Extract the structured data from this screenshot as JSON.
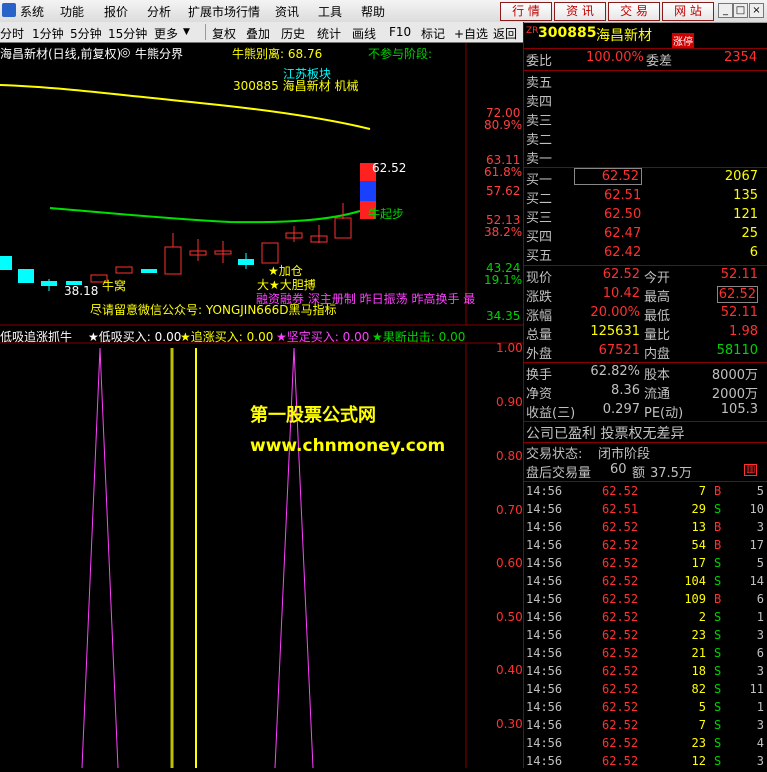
{
  "menu": {
    "items": [
      "系统",
      "功能",
      "报价",
      "分析",
      "扩展市场行情",
      "资讯",
      "工具",
      "帮助"
    ],
    "right_buttons": [
      "行 情",
      "资 讯",
      "交 易",
      "网 站"
    ]
  },
  "toolbar": {
    "left_items": [
      "分时",
      "1分钟",
      "5分钟",
      "15分钟",
      "更多"
    ],
    "right_items": [
      "复权",
      "叠加",
      "历史",
      "统计",
      "画线",
      "F10",
      "标记",
      "+自选",
      "返回"
    ]
  },
  "main_chart": {
    "title": "海昌新材(日线,前复权)",
    "indicator_label": "牛熊分界",
    "bull_bear_value_label": "牛熊别离: 68.76",
    "phase_label": "不参与阶段: ",
    "annot_jiangsu": "江苏板块",
    "annot_machinery": "300885 海昌新材 机械",
    "last_price_label": "62.52",
    "low_price_label": "38.18",
    "niu_qibu": "牛起步",
    "jiacang": "★加仓",
    "dadan": "大★大胆搏",
    "niuwo": "牛窝",
    "notice": "尽请留意微信公众号: YONGJIN666D黑马指标",
    "scroll_text": "融资融券 深主册制 昨日振荡 昨高换手 最",
    "axis_labels": [
      {
        "v": "72.00",
        "c": "#ff4040"
      },
      {
        "v": "80.9%",
        "c": "#ff4040"
      },
      {
        "v": "63.11",
        "c": "#ff4040"
      },
      {
        "v": "61.8%",
        "c": "#ff4040"
      },
      {
        "v": "57.62",
        "c": "#ff4040"
      },
      {
        "v": "52.13",
        "c": "#ff4040"
      },
      {
        "v": "38.2%",
        "c": "#ff4040"
      },
      {
        "v": "43.24",
        "c": "#00d200"
      },
      {
        "v": "19.1%",
        "c": "#00d200"
      },
      {
        "v": "34.35",
        "c": "#00d200"
      }
    ]
  },
  "sub_chart": {
    "name": "低吸追涨抓牛",
    "legend": [
      {
        "label": "★低吸买入: 0.00",
        "color": "#ffffff"
      },
      {
        "label": "★追涨买入: 0.00",
        "color": "#ffff00"
      },
      {
        "label": "★坚定买入: 0.00",
        "color": "#ff40ff"
      },
      {
        "label": "★果断出击: 0.00",
        "color": "#00d200"
      }
    ],
    "axis": [
      "1.00",
      "0.90",
      "0.80",
      "0.70",
      "0.60",
      "0.50",
      "0.40",
      "0.30"
    ],
    "watermark1": "第一股票公式网",
    "watermark2": "www.chnmoney.com"
  },
  "quote": {
    "code": "300885",
    "name": "海昌新材",
    "tag": "涨停",
    "weibi_label": "委比",
    "weibi": "100.00%",
    "weicha_label": "委差",
    "weicha": "2354",
    "sell_labels": [
      "卖五",
      "卖四",
      "卖三",
      "卖二",
      "卖一"
    ],
    "buy": [
      {
        "label": "买一",
        "price": "62.52",
        "vol": "2067"
      },
      {
        "label": "买二",
        "price": "62.51",
        "vol": "135"
      },
      {
        "label": "买三",
        "price": "62.50",
        "vol": "121"
      },
      {
        "label": "买四",
        "price": "62.47",
        "vol": "25"
      },
      {
        "label": "买五",
        "price": "62.42",
        "vol": "6"
      }
    ],
    "stats": [
      {
        "l1": "现价",
        "v1": "62.52",
        "l2": "今开",
        "v2": "52.11",
        "c1": "#ff3030",
        "c2": "#ff3030"
      },
      {
        "l1": "涨跌",
        "v1": "10.42",
        "l2": "最高",
        "v2": "62.52",
        "c1": "#ff3030",
        "c2": "#ff3030"
      },
      {
        "l1": "涨幅",
        "v1": "20.00%",
        "l2": "最低",
        "v2": "52.11",
        "c1": "#ff3030",
        "c2": "#ff3030"
      },
      {
        "l1": "总量",
        "v1": "125631",
        "l2": "量比",
        "v2": "1.98",
        "c1": "#ffff00",
        "c2": "#ff3030"
      },
      {
        "l1": "外盘",
        "v1": "67521",
        "l2": "内盘",
        "v2": "58110",
        "c1": "#ff3030",
        "c2": "#00d200"
      }
    ],
    "stats2": [
      {
        "l1": "换手",
        "v1": "62.82%",
        "l2": "股本",
        "v2": "8000万"
      },
      {
        "l1": "净资",
        "v1": "8.36",
        "l2": "流通",
        "v2": "2000万"
      },
      {
        "l1": "收益(三)",
        "v1": "0.297",
        "l2": "PE(动)",
        "v2": "105.3"
      }
    ],
    "profit_line": "公司已盈利 投票权无差异",
    "trade_state_label": "交易状态:",
    "trade_state": "闭市阶段",
    "after_label": "盘后交易量",
    "after_vol": "60",
    "after_amt_label": "额",
    "after_amt": "37.5万"
  },
  "ticks": [
    {
      "t": "14:56",
      "p": "62.52",
      "v": "7",
      "d": "B",
      "n": "5"
    },
    {
      "t": "14:56",
      "p": "62.51",
      "v": "29",
      "d": "S",
      "n": "10"
    },
    {
      "t": "14:56",
      "p": "62.52",
      "v": "13",
      "d": "B",
      "n": "3"
    },
    {
      "t": "14:56",
      "p": "62.52",
      "v": "54",
      "d": "B",
      "n": "17"
    },
    {
      "t": "14:56",
      "p": "62.52",
      "v": "17",
      "d": "S",
      "n": "5"
    },
    {
      "t": "14:56",
      "p": "62.52",
      "v": "104",
      "d": "S",
      "n": "14"
    },
    {
      "t": "14:56",
      "p": "62.52",
      "v": "109",
      "d": "B",
      "n": "6"
    },
    {
      "t": "14:56",
      "p": "62.52",
      "v": "2",
      "d": "S",
      "n": "1"
    },
    {
      "t": "14:56",
      "p": "62.52",
      "v": "23",
      "d": "S",
      "n": "3"
    },
    {
      "t": "14:56",
      "p": "62.52",
      "v": "21",
      "d": "S",
      "n": "6"
    },
    {
      "t": "14:56",
      "p": "62.52",
      "v": "18",
      "d": "S",
      "n": "3"
    },
    {
      "t": "14:56",
      "p": "62.52",
      "v": "82",
      "d": "S",
      "n": "11"
    },
    {
      "t": "14:56",
      "p": "62.52",
      "v": "5",
      "d": "S",
      "n": "1"
    },
    {
      "t": "14:56",
      "p": "62.52",
      "v": "7",
      "d": "S",
      "n": "3"
    },
    {
      "t": "14:56",
      "p": "62.52",
      "v": "23",
      "d": "S",
      "n": "4"
    },
    {
      "t": "14:56",
      "p": "62.52",
      "v": "12",
      "d": "S",
      "n": "3"
    }
  ],
  "colors": {
    "up": "#ff3030",
    "down": "#00d200",
    "bg": "#000000",
    "frame": "#800000"
  }
}
